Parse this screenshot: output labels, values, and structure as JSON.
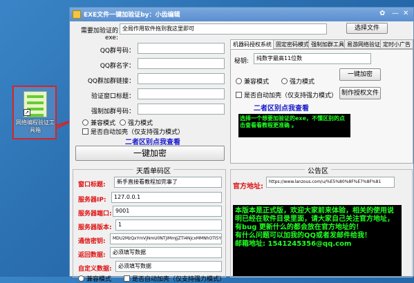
{
  "desktop_icon": {
    "label": "网络编程验证工具箱",
    "shortcut_glyph": "↗"
  },
  "window": {
    "title": "EXE文件一键加验证by：小齿编辑",
    "path_label": "需要加验证的exe:",
    "path_value": "全局作用软件拖到我这里即可",
    "choose_file": "选择文件"
  },
  "left_form": {
    "qq_group_no": "QQ群号码：",
    "qq_group_name": "QQ群名字：",
    "qq_group_join": "QQ群加群链接：",
    "verify_title": "验证窗口标题：",
    "force_join": "强制加群号码：",
    "compat_mode": "兼容模式",
    "force_mode": "强力模式",
    "auto_shell": "是否自动加壳（仅支持强力模式）",
    "hint": "二者区别点我查看",
    "one_key": "一键加密"
  },
  "tabs": [
    "机器码授权系统",
    "固定密码模式",
    "强制加群工具",
    "易游网络验证",
    "定时小广告"
  ],
  "right_form": {
    "key_label": "秘钥:",
    "key_value": "纯数字最高11位数",
    "compat_mode": "兼容模式",
    "force_mode": "强力模式",
    "one_key": "一键加密",
    "auto_shell": "是否自动加壳（仅支持强力模式）",
    "make_auth": "制作授权文件",
    "hint": "二者区别点我查看",
    "green_text": "选择一个想要加验证的exe，不懂区别的点击查看看教程更准确 。"
  },
  "tiandun": {
    "title": "天盾单码区",
    "window_title_label": "窗口标题:",
    "window_title_value": "新手直接看教程加完事了",
    "server_ip_label": "服务器IP:",
    "server_ip_value": "127.0.0.1",
    "server_port_label": "服务器端口:",
    "server_port_value": "9001",
    "server_ver_label": "服务器版本:",
    "server_ver_value": "1",
    "comm_key_label": "通信密钥:",
    "comm_key_value": "MDU2MzQxYmVjNmU0NTJiMmJjZTI4NjcxMMNhOTI5YmU=",
    "return_data_label": "返回数据:",
    "return_data_value": "必须填写数据",
    "custom_data_label": "自定义数据:",
    "custom_data_value": "必须填写数据",
    "compat_mode": "兼容模式",
    "auto_shell": "是否自动加壳（仅支持强力模式）"
  },
  "notice": {
    "title": "公告区",
    "url_label": "官方地址:",
    "url_value": "https://www.lanzous.com/u/%E5%80%8F%E7%8F%81",
    "body": "本版本是正式版，欢迎大家前来体验，相关的使用说明已经在软件目录里面，请大家自己关注官方地址，有bug 更新什么的都会放在官方地址的！\n有什么问题可以加我的QQ或者发邮件给我！\n邮箱地址: 1541245356@qq.com"
  },
  "colors": {
    "desktop": "#2a6fb0",
    "green_text": "#22ff22",
    "red": "#d11111",
    "hint_blue": "#1a1acc"
  }
}
